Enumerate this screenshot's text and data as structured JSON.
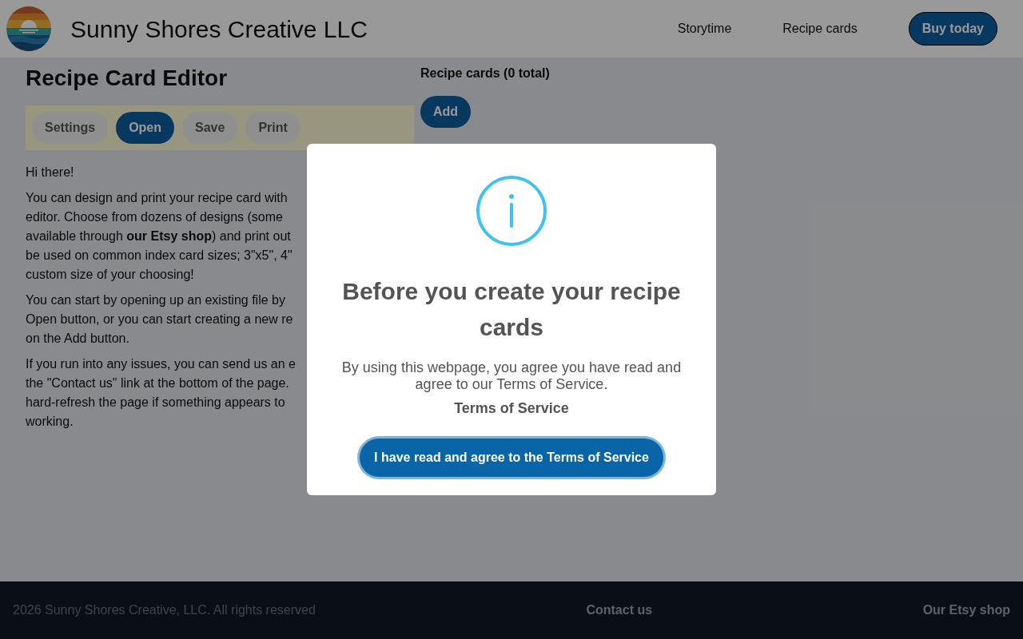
{
  "header": {
    "brand": "Sunny Shores Creative LLC",
    "nav": [
      {
        "label": "Storytime",
        "kind": "link"
      },
      {
        "label": "Recipe cards",
        "kind": "link"
      },
      {
        "label": "Buy today",
        "kind": "button"
      }
    ]
  },
  "editor": {
    "title": "Recipe Card Editor",
    "toolbar": [
      {
        "label": "Settings",
        "selected": false
      },
      {
        "label": "Open",
        "selected": true
      },
      {
        "label": "Save",
        "selected": false
      },
      {
        "label": "Print",
        "selected": false
      }
    ],
    "paragraphs": [
      {
        "lines": [
          "Hi there!"
        ]
      },
      {
        "lines": [
          "You can design and print your recipe card with",
          "editor. Choose from dozens of designs (some",
          "available through **our Etsy shop**) and print out",
          "be used on common index card sizes; 3\"x5\", 4\"",
          "custom size of your choosing!"
        ]
      },
      {
        "lines": [
          "You can start by opening up an existing file by",
          "Open button, or you can start creating a new re",
          "on the Add button."
        ]
      },
      {
        "lines": [
          "If you run into any issues, you can send us an e",
          "the \"Contact us\" link at the bottom of the page.",
          "hard-refresh the page if something appears to",
          "working."
        ]
      }
    ]
  },
  "cards_panel": {
    "heading": "Recipe cards (0 total)",
    "add_button": "Add"
  },
  "footer": {
    "copyright": "2026 Sunny Shores Creative, LLC. All rights reserved",
    "links": [
      "Contact us",
      "Our Etsy shop"
    ]
  },
  "dialog": {
    "title": "Before you create your recipe cards",
    "message": "By using this webpage, you agree you have read and agree to our Terms of Service.",
    "link": "Terms of Service",
    "confirm_button": "I have read and agree to the Terms of Service"
  }
}
